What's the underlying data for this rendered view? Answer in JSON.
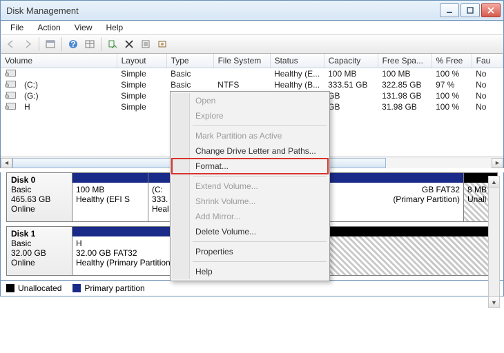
{
  "title": "Disk Management",
  "menu": {
    "file": "File",
    "action": "Action",
    "view": "View",
    "help": "Help"
  },
  "columns": [
    "Volume",
    "Layout",
    "Type",
    "File System",
    "Status",
    "Capacity",
    "Free Spa...",
    "% Free",
    "Fau"
  ],
  "volumes": [
    {
      "vol": "",
      "layout": "Simple",
      "type": "Basic",
      "fs": "",
      "status": "Healthy (E...",
      "cap": "100 MB",
      "free": "100 MB",
      "pct": "100 %",
      "fault": "No"
    },
    {
      "vol": "(C:)",
      "layout": "Simple",
      "type": "Basic",
      "fs": "NTFS",
      "status": "Healthy (B...",
      "cap": "333.51 GB",
      "free": "322.85 GB",
      "pct": "97 %",
      "fault": "No"
    },
    {
      "vol": "(G:)",
      "layout": "Simple",
      "type": "B",
      "fs": "",
      "status": "",
      "cap": "GB",
      "free": "131.98 GB",
      "pct": "100 %",
      "fault": "No"
    },
    {
      "vol": "H",
      "layout": "Simple",
      "type": "B",
      "fs": "",
      "status": "",
      "cap": "GB",
      "free": "31.98 GB",
      "pct": "100 %",
      "fault": "No"
    }
  ],
  "disk0": {
    "name": "Disk 0",
    "type": "Basic",
    "size": "465.63 GB",
    "state": "Online",
    "p0": {
      "size": "100 MB",
      "stat": "Healthy (EFI S"
    },
    "p1": {
      "letter": "(C:",
      "size": "333.",
      "stat": "Heal"
    },
    "p2": {
      "size": "GB FAT32",
      "stat": "(Primary Partition)"
    },
    "p3": {
      "size": "8 MB",
      "stat": "Unall"
    }
  },
  "disk1": {
    "name": "Disk 1",
    "type": "Basic",
    "size": "32.00 GB",
    "state": "Online",
    "p0": {
      "letter": "H",
      "size": "32.00 GB FAT32",
      "stat": "Healthy (Primary Partition)"
    }
  },
  "legend": {
    "unalloc": "Unallocated",
    "primary": "Primary partition"
  },
  "ctx": {
    "open": "Open",
    "explore": "Explore",
    "mark": "Mark Partition as Active",
    "change": "Change Drive Letter and Paths...",
    "format": "Format...",
    "extend": "Extend Volume...",
    "shrink": "Shrink Volume...",
    "mirror": "Add Mirror...",
    "delete": "Delete Volume...",
    "props": "Properties",
    "help": "Help"
  }
}
